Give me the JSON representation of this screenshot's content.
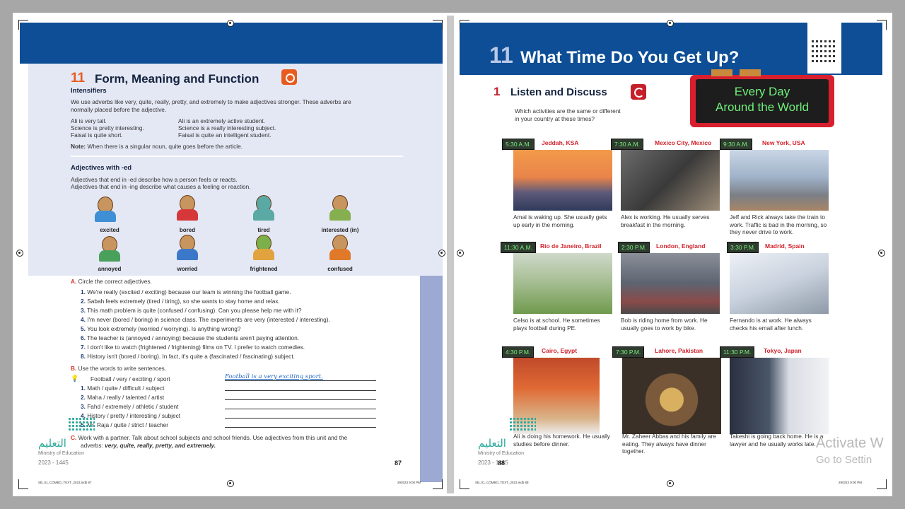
{
  "left": {
    "unit_number": "11",
    "section_title": "Form, Meaning and Function",
    "intensifiers": {
      "heading": "Intensifiers",
      "intro_line1": "We use adverbs like very, quite, really, pretty, and extremely to make adjectives stronger. These adverbs are",
      "intro_line2": "normally placed before the adjective.",
      "examples_left": [
        "Ali is very tall.",
        "Science is pretty interesting.",
        "Faisal is quite short."
      ],
      "examples_right": [
        "Ali is an extremely active student.",
        "Science is a really interesting subject.",
        "Faisal is quite an intelligent student."
      ],
      "note_label": "Note:",
      "note_text": "When there is a singular noun, quite goes before the article."
    },
    "adjectives_ed": {
      "heading": "Adjectives with -ed",
      "line1": "Adjectives that end in -ed describe how a person feels or reacts.",
      "line2": "Adjectives that end in -ing describe what causes a feeling or reaction.",
      "row1": [
        "excited",
        "bored",
        "tired",
        "interested (in)"
      ],
      "row2": [
        "annoyed",
        "worried",
        "frightened",
        "confused"
      ]
    },
    "exercise_a": {
      "letter": "A.",
      "instruction": "Circle the correct adjectives.",
      "items": [
        {
          "n": "1.",
          "text": "We're really (excited / exciting) because our team is winning the football game."
        },
        {
          "n": "2.",
          "text": "Sabah feels extremely (tired / tiring), so she wants to stay home and relax."
        },
        {
          "n": "3.",
          "text": "This math problem is quite (confused / confusing). Can you please help me with it?"
        },
        {
          "n": "4.",
          "text": "I'm never (bored / boring) in science class. The experiments are very (interested / interesting)."
        },
        {
          "n": "5.",
          "text": "You look extremely (worried / worrying). Is anything wrong?"
        },
        {
          "n": "6.",
          "text": "The teacher is (annoyed / annoying) because the students aren't paying attention."
        },
        {
          "n": "7.",
          "text": "I don't like to watch (frightened / frightening) films on TV. I prefer to watch comedies."
        },
        {
          "n": "8.",
          "text": "History isn't (bored / boring). In fact, it's quite a (fascinated / fascinating) subject."
        }
      ]
    },
    "exercise_b": {
      "letter": "B.",
      "instruction": "Use the words to write sentences.",
      "example_prompt": "Football / very / exciting / sport",
      "example_answer": "Football is a very exciting sport.",
      "items": [
        {
          "n": "1.",
          "text": "Math / quite / difficult / subject"
        },
        {
          "n": "2.",
          "text": "Maha / really / talented / artist"
        },
        {
          "n": "3.",
          "text": "Fahd / extremely / athletic / student"
        },
        {
          "n": "4.",
          "text": "History / pretty / interesting / subject"
        },
        {
          "n": "5.",
          "text": "Mr. Raja / quite / strict / teacher"
        }
      ]
    },
    "exercise_c": {
      "letter": "C.",
      "line1": "Work with a partner. Talk about school subjects and school friends. Use adjectives from this unit and the",
      "line2_prefix": "adverbs:",
      "line2_adverbs": "very, quite, really, pretty, and extremely."
    },
    "logo_text": "التعليم",
    "ministry": "Ministry of Education",
    "year": "2023 - 1445",
    "page_number": "87",
    "slug_left": "SB_01_COMBO_TEXT_2023.indb 87",
    "slug_right": "29/3/23 9:00 PM"
  },
  "right": {
    "unit_number": "11",
    "title": "What Time Do You Get Up?",
    "sign_line1": "Every Day",
    "sign_line2": "Around the World",
    "section_number": "1",
    "section_title": "Listen and Discuss",
    "question_line1": "Which activities are the same or different",
    "question_line2": "in your country at these times?",
    "cards": [
      {
        "time": "5:30 A.M.",
        "city": "Jeddah, KSA",
        "caption": "Amal is waking up. She usually gets up early in the morning."
      },
      {
        "time": "7:30 A.M.",
        "city": "Mexico City, Mexico",
        "caption": "Alex is working. He usually serves breakfast in the morning."
      },
      {
        "time": "9:30 A.M.",
        "city": "New York, USA",
        "caption": "Jeff and Rick always take the train to work. Traffic is bad in the morning, so they never drive to work."
      },
      {
        "time": "11:30 A.M.",
        "city": "Rio de Janeiro, Brazil",
        "caption": "Celso is at school. He sometimes plays football during PE."
      },
      {
        "time": "2:30 P.M.",
        "city": "London, England",
        "caption": "Bob is riding home from work. He usually goes to work by bike."
      },
      {
        "time": "3:30 P.M.",
        "city": "Madrid, Spain",
        "caption": "Fernando is at work. He always checks his email after lunch."
      },
      {
        "time": "4:30 P.M.",
        "city": "Cairo, Egypt",
        "caption": "Ali is doing his homework. He usually studies before dinner."
      },
      {
        "time": "7:30 P.M.",
        "city": "Lahore, Pakistan",
        "caption": "Mr. Zaheer Abbas and his family are eating. They always have dinner together."
      },
      {
        "time": "11:30 P.M.",
        "city": "Tokyo, Japan",
        "caption": "Takeshi is going back home. He is a lawyer and he usually works late."
      }
    ],
    "logo_text": "التعليم",
    "ministry": "Ministry of Education",
    "year": "2023 - 1445",
    "page_number": "88",
    "slug_left": "SB_01_COMBO_TEXT_2023.indb 88",
    "slug_right": "29/3/23 9:00 PM",
    "watermark_line1": "Activate W",
    "watermark_line2": "Go to Settin"
  },
  "colors": {
    "header_blue": "#0d4e96",
    "accent_orange": "#e85b1f",
    "accent_red": "#d2232d",
    "clock_green": "#6ff07a",
    "page_tint": "#e4e8f5",
    "moe_teal": "#2aa89b"
  }
}
